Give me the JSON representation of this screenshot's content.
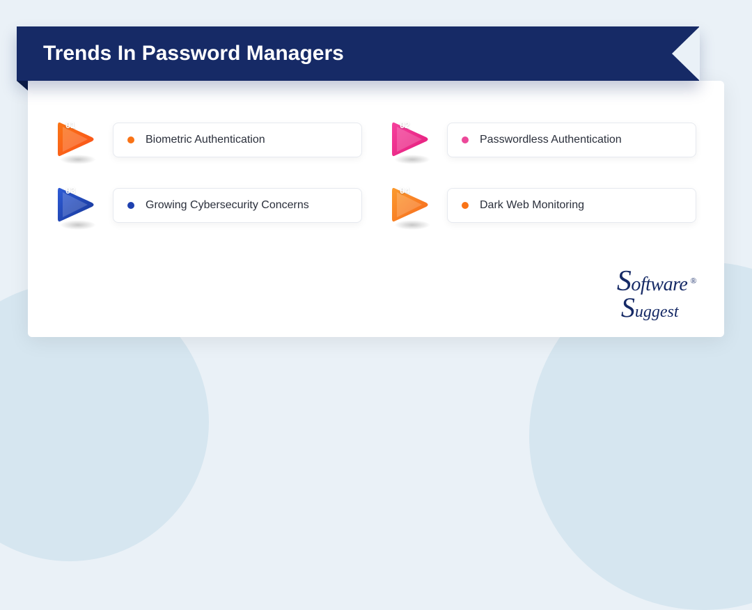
{
  "title": "Trends In Password Managers",
  "items": [
    {
      "num": "01",
      "label": "Biometric Authentication",
      "grad_a": "#f97516",
      "grad_b": "#fb4f1a",
      "dot": "#f97316"
    },
    {
      "num": "02",
      "label": "Passwordless Authentication",
      "grad_a": "#f5419c",
      "grad_b": "#e41b7b",
      "dot": "#ec4899"
    },
    {
      "num": "03",
      "label": "Growing Cybersecurity Concerns",
      "grad_a": "#2e5bd6",
      "grad_b": "#163696",
      "dot": "#1e40af"
    },
    {
      "num": "04",
      "label": "Dark Web Monitoring",
      "grad_a": "#fb9a2e",
      "grad_b": "#f6691c",
      "dot": "#f97316"
    }
  ],
  "brand": {
    "line1_big": "S",
    "line1_rest": "oftware",
    "line2_big": "S",
    "line2_rest": "uggest",
    "reg": "®"
  }
}
